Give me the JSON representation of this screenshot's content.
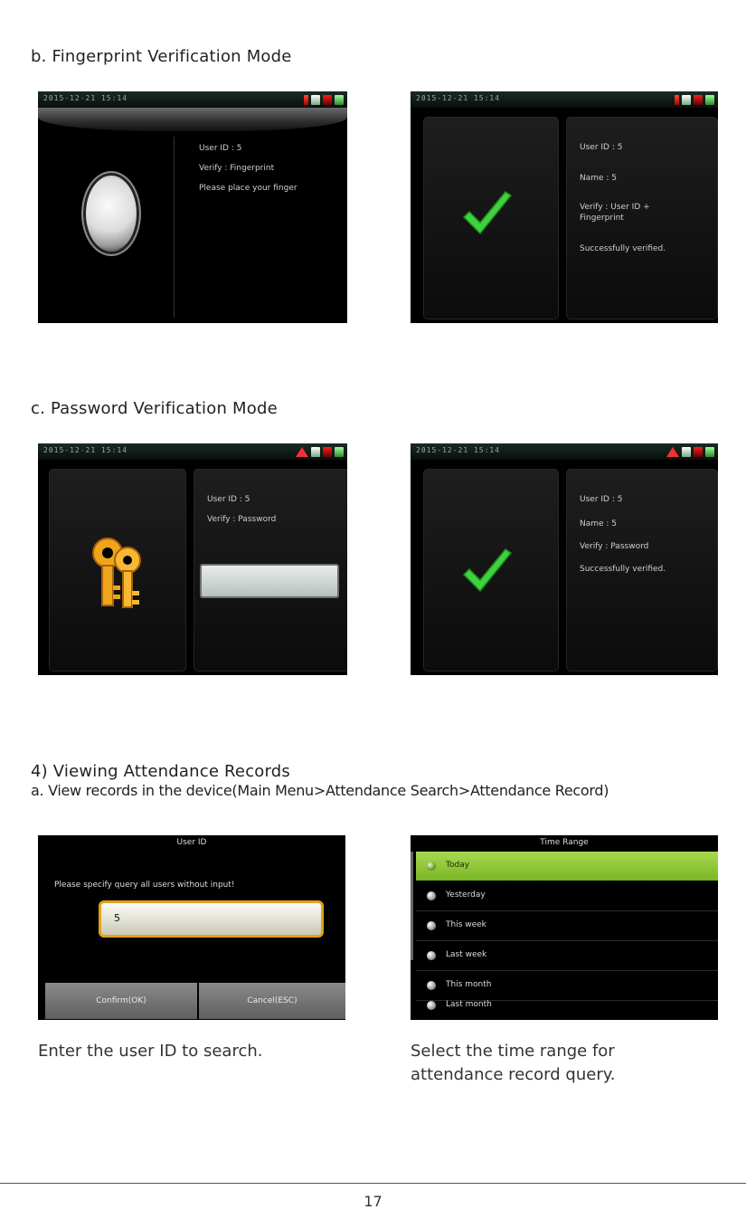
{
  "sections": {
    "fingerprint_heading": "b. Fingerprint Verification Mode",
    "password_heading": "c. Password Verification Mode",
    "attendance_heading": "4) Viewing Attendance Records",
    "attendance_sub": "a. View records in the device(Main Menu>Attendance Search>Attendance Record)"
  },
  "screens": {
    "fp_prompt": {
      "time": "2015-12-21 15:14",
      "lines": [
        "User ID : 5",
        "Verify : Fingerprint",
        "Please place your finger"
      ],
      "icons": [
        "alarm-icon",
        "hand-icon",
        "card-icon",
        "battery-icon"
      ]
    },
    "fp_success": {
      "time": "2015-12-21 15:14",
      "lines": [
        "User ID : 5",
        "Name : 5",
        "Verify : User ID +",
        "Fingerprint",
        "Successfully verified."
      ],
      "icons": [
        "alarm-icon",
        "hand-icon",
        "card-icon",
        "battery-icon"
      ]
    },
    "pw_prompt": {
      "time": "2015-12-21 15:14",
      "lines": [
        "User ID : 5",
        "Verify : Password"
      ],
      "icons": [
        "warning-icon",
        "hand-icon",
        "card-icon",
        "battery-icon"
      ]
    },
    "pw_success": {
      "time": "2015-12-21 15:14",
      "lines": [
        "User ID : 5",
        "Name : 5",
        "Verify : Password",
        "Successfully verified."
      ],
      "icons": [
        "warning-icon",
        "hand-icon",
        "card-icon",
        "battery-icon"
      ]
    },
    "user_id": {
      "title": "User ID",
      "prompt": "Please specify query all users without input!",
      "value": "5",
      "confirm": "Confirm(OK)",
      "cancel": "Cancel(ESC)"
    },
    "time_range": {
      "title": "Time Range",
      "items": [
        "Today",
        "Yesterday",
        "This week",
        "Last week",
        "This month",
        "Last month"
      ],
      "selected_index": 0
    }
  },
  "captions": {
    "user_id": "Enter the user ID to search.",
    "time_range": "Select the time range for attendance record query."
  },
  "page_number": "17",
  "colors": {
    "check": "#3fd23f",
    "highlight": "#a8d950",
    "input_border": "#e0a21b"
  }
}
